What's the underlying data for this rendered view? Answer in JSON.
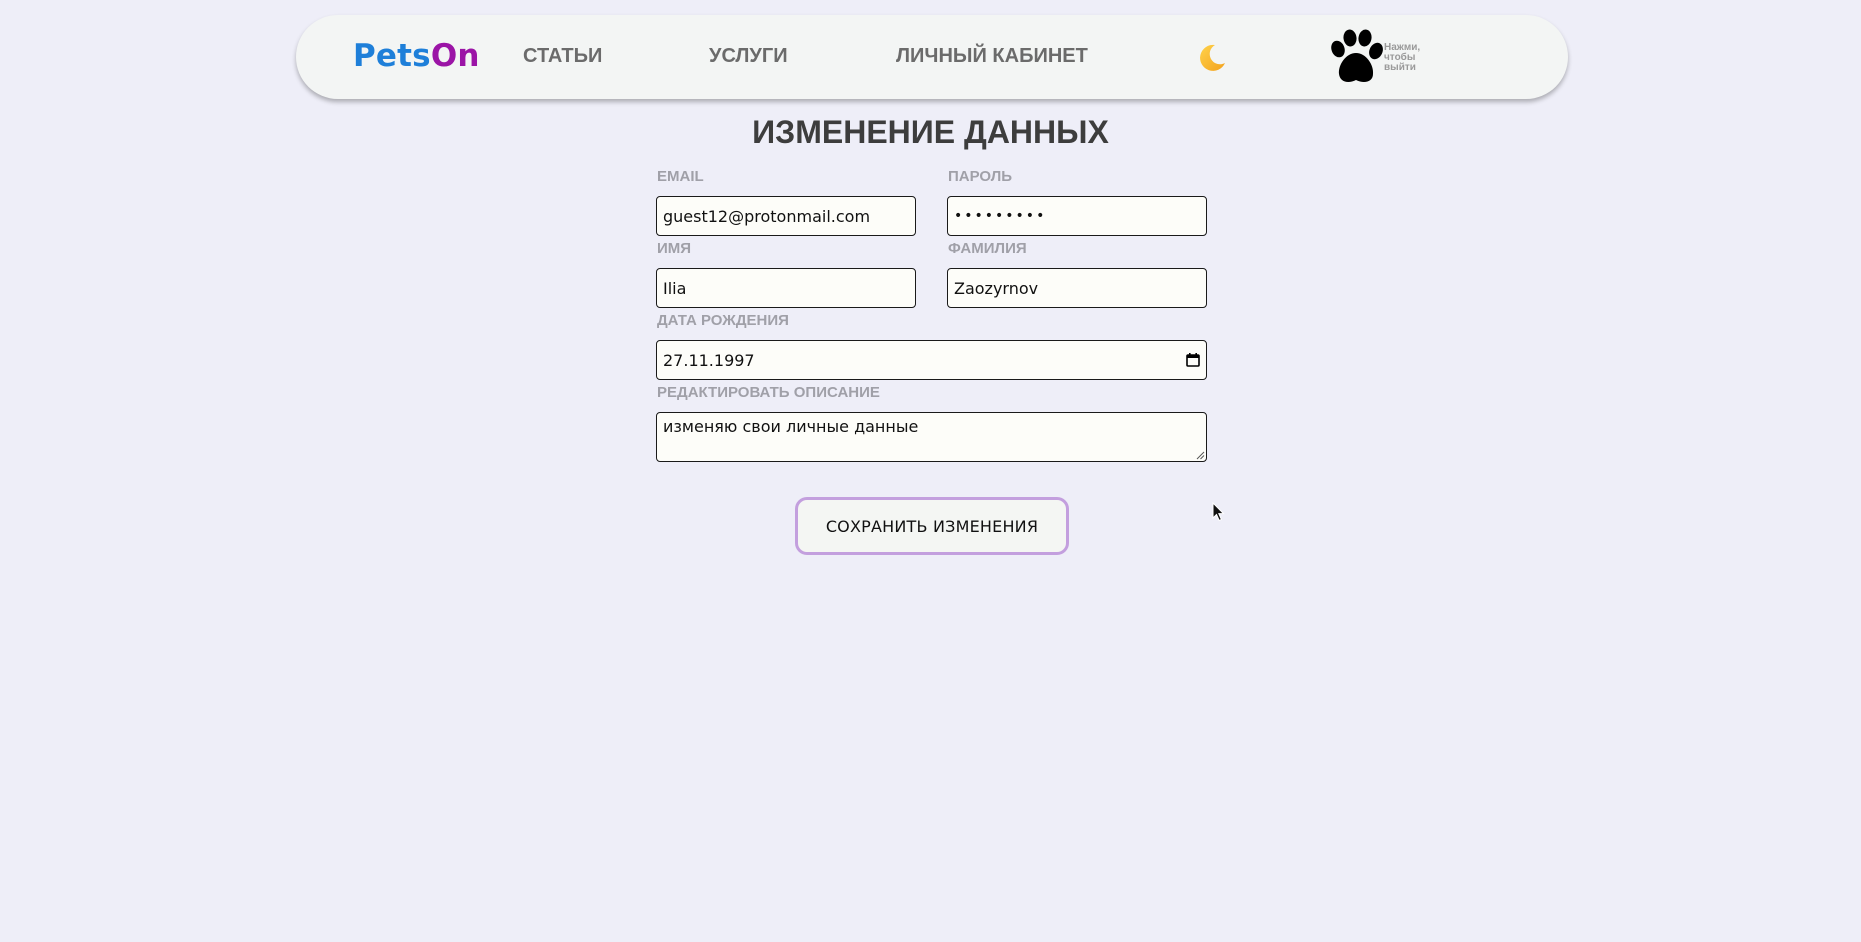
{
  "nav": {
    "logo_part1": "Pets",
    "logo_part2": "On",
    "links": [
      "СТАТЬИ",
      "УСЛУГИ",
      "ЛИЧНЫЙ КАБИНЕТ"
    ],
    "theme_icon": "moon-icon",
    "avatar_icon": "paw-icon",
    "logout_hint": "Нажми, чтобы выйти"
  },
  "page": {
    "title": "ИЗМЕНЕНИЕ ДАННЫХ"
  },
  "form": {
    "email": {
      "label": "EMAIL",
      "value": "guest12@protonmail.com"
    },
    "password": {
      "label": "ПАРОЛЬ",
      "value": "•••••••••"
    },
    "first_name": {
      "label": "ИМЯ",
      "value": "Ilia"
    },
    "last_name": {
      "label": "ФАМИЛИЯ",
      "value": "Zaozyrnov"
    },
    "birth_date": {
      "label": "ДАТА РОЖДЕНИЯ",
      "value": "27.11.1997",
      "icon": "calendar-icon"
    },
    "description": {
      "label": "РЕДАКТИРОВАТЬ ОПИСАНИЕ",
      "value": "изменяю свои личные данные"
    },
    "save_label": "СОХРАНИТЬ ИЗМЕНЕНИЯ"
  },
  "colors": {
    "background": "#eeeef8",
    "logo_blue": "#1e7fd9",
    "logo_purple": "#9b14a6",
    "button_border": "#c39fde"
  }
}
